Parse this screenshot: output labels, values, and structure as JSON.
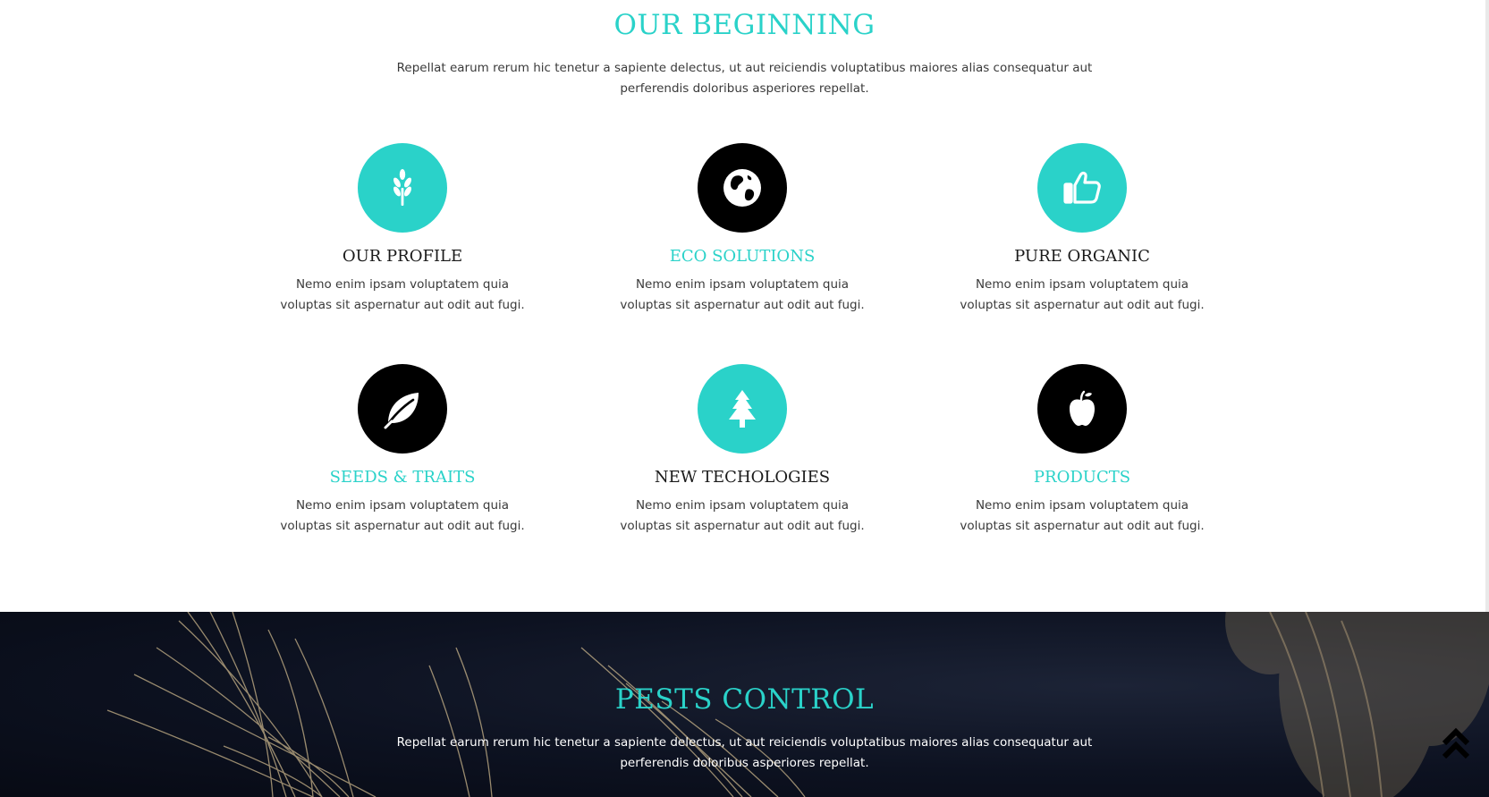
{
  "colors": {
    "accent": "#2ad2c9",
    "dark": "#000000",
    "text": "#3a3a3a"
  },
  "beginning": {
    "title": "OUR BEGINNING",
    "intro": "Repellat earum rerum hic tenetur a sapiente delectus, ut aut reiciendis voluptatibus maiores alias consequatur aut perferendis doloribus asperiores repellat."
  },
  "features": [
    {
      "title": "OUR PROFILE",
      "icon": "wheat-icon",
      "circle": "teal",
      "title_color": "dark",
      "text": "Nemo enim ipsam voluptatem quia voluptas sit aspernatur aut odit aut fugi."
    },
    {
      "title": "ECO SOLUTIONS",
      "icon": "globe-icon",
      "circle": "black",
      "title_color": "accent",
      "text": "Nemo enim ipsam voluptatem quia voluptas sit aspernatur aut odit aut fugi."
    },
    {
      "title": "PURE ORGANIC",
      "icon": "thumbs-up-icon",
      "circle": "teal",
      "title_color": "dark",
      "text": "Nemo enim ipsam voluptatem quia voluptas sit aspernatur aut odit aut fugi."
    },
    {
      "title": "SEEDS & TRAITS",
      "icon": "leaf-icon",
      "circle": "black",
      "title_color": "accent",
      "text": "Nemo enim ipsam voluptatem quia voluptas sit aspernatur aut odit aut fugi."
    },
    {
      "title": "NEW TECHOLOGIES",
      "icon": "tree-icon",
      "circle": "teal",
      "title_color": "dark",
      "text": "Nemo enim ipsam voluptatem quia voluptas sit aspernatur aut odit aut fugi."
    },
    {
      "title": "PRODUCTS",
      "icon": "apple-icon",
      "circle": "black",
      "title_color": "accent",
      "text": "Nemo enim ipsam voluptatem quia voluptas sit aspernatur aut odit aut fugi."
    }
  ],
  "pests": {
    "title": "PESTS CONTROL",
    "intro": "Repellat earum rerum hic tenetur a sapiente delectus, ut aut reiciendis voluptatibus maiores alias consequatur aut perferendis doloribus asperiores repellat."
  },
  "scroll_top": {
    "icon": "double-chevron-up-icon"
  }
}
